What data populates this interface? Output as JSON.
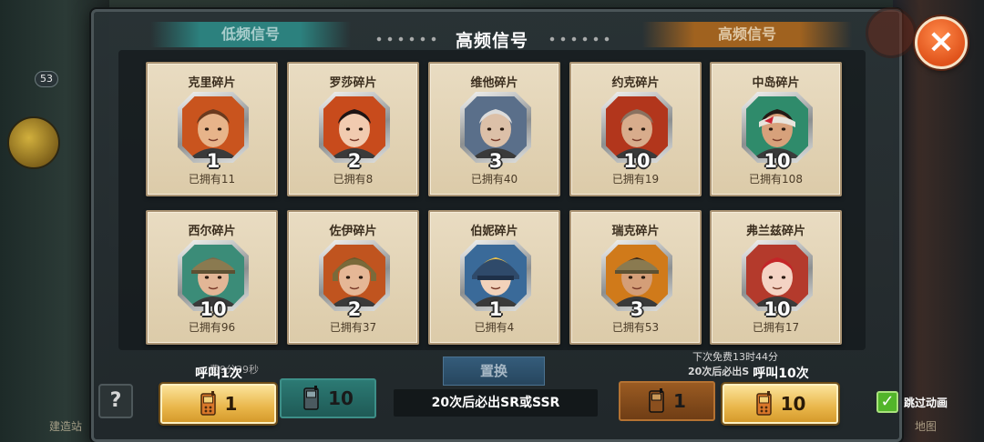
{
  "background": {
    "level": "53",
    "left_label": "建造站",
    "right_label": "地图"
  },
  "tabs": {
    "left": "低频信号",
    "right": "高频信号"
  },
  "title": "高频信号",
  "close_icon": "×",
  "cards": [
    {
      "name": "克里碎片",
      "qty": "1",
      "owned": "已拥有11",
      "skin": "#e7b48a",
      "hair": "#6b3a1e",
      "bg": "#c9541e",
      "helmet": ""
    },
    {
      "name": "罗莎碎片",
      "qty": "2",
      "owned": "已拥有8",
      "skin": "#f1cbb0",
      "hair": "#1e1414",
      "bg": "#c84b1c",
      "helmet": ""
    },
    {
      "name": "维他碎片",
      "qty": "3",
      "owned": "已拥有40",
      "skin": "#dcc0a8",
      "hair": "#dcdcdc",
      "bg": "#5a6f8a",
      "helmet": ""
    },
    {
      "name": "约克碎片",
      "qty": "10",
      "owned": "已拥有19",
      "skin": "#d8ac8c",
      "hair": "#8a7160",
      "bg": "#b2361c",
      "helmet": ""
    },
    {
      "name": "中岛碎片",
      "qty": "10",
      "owned": "已拥有108",
      "skin": "#d7a17b",
      "hair": "#241a15",
      "bg": "#2f8b6b",
      "helmet": "band"
    },
    {
      "name": "西尔碎片",
      "qty": "10",
      "owned": "已拥有96",
      "skin": "#e2b696",
      "hair": "#7b6a4a",
      "bg": "#3b8c78",
      "helmet": "cap"
    },
    {
      "name": "佐伊碎片",
      "qty": "2",
      "owned": "已拥有37",
      "skin": "#e5b796",
      "hair": "#6c5a2c",
      "bg": "#c0541f",
      "helmet": "pilot"
    },
    {
      "name": "伯妮碎片",
      "qty": "1",
      "owned": "已拥有4",
      "skin": "#f2d2ba",
      "hair": "#e9c04a",
      "bg": "#3a6a99",
      "helmet": "steel"
    },
    {
      "name": "瑞克碎片",
      "qty": "3",
      "owned": "已拥有53",
      "skin": "#d49e78",
      "hair": "#3b2a1b",
      "bg": "#d07a1a",
      "helmet": "cap"
    },
    {
      "name": "弗兰兹碎片",
      "qty": "10",
      "owned": "已拥有17",
      "skin": "#f4d3c4",
      "hair": "#c42528",
      "bg": "#b43a2c",
      "helmet": ""
    }
  ],
  "bottom": {
    "help": "?",
    "call1_label": "呼叫1次",
    "call1_cost": "1",
    "call10_dim_cost": "10",
    "swap": "置换",
    "guarantee": "20次后必出SR或SSR",
    "timer_left": "费9分39秒",
    "timer_right_1": "下次免费13时44分",
    "timer_right_2": "20次后必出S",
    "call1_dim_cost": "1",
    "call10_label": "呼叫10次",
    "call10_cost": "10",
    "skip_label": "跳过动画",
    "skip_checked": true
  },
  "colors": {
    "gold": "#e9b64a",
    "close": "#e0531b",
    "teal": "#2d8f8b",
    "check": "#52b52a"
  }
}
